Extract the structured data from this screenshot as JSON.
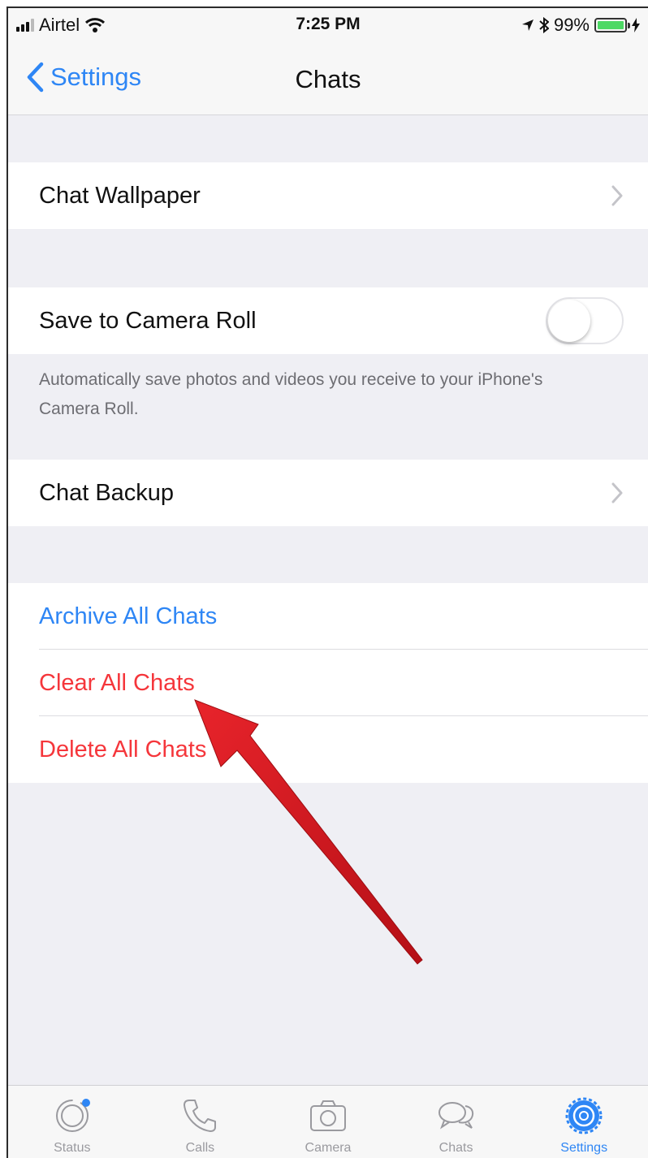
{
  "status_bar": {
    "carrier": "Airtel",
    "time": "7:25 PM",
    "battery": "99%",
    "battery_level": 0.99
  },
  "nav": {
    "back_label": "Settings",
    "title": "Chats"
  },
  "rows": {
    "wallpaper": "Chat Wallpaper",
    "save_camera_roll": "Save to Camera Roll",
    "save_camera_roll_on": false,
    "save_footnote": "Automatically save photos and videos you receive to your iPhone's Camera Roll.",
    "backup": "Chat Backup",
    "archive_all": "Archive All Chats",
    "clear_all": "Clear All Chats",
    "delete_all": "Delete All Chats"
  },
  "colors": {
    "accent_blue": "#2e86f5",
    "destructive_red": "#f5363b",
    "annotation_arrow": "#d4151d",
    "background": "#efeff4"
  },
  "tabs": [
    {
      "label": "Status",
      "icon": "status-icon",
      "active": false
    },
    {
      "label": "Calls",
      "icon": "phone-icon",
      "active": false
    },
    {
      "label": "Camera",
      "icon": "camera-icon",
      "active": false
    },
    {
      "label": "Chats",
      "icon": "chat-bubbles-icon",
      "active": false
    },
    {
      "label": "Settings",
      "icon": "gear-icon",
      "active": true
    }
  ]
}
